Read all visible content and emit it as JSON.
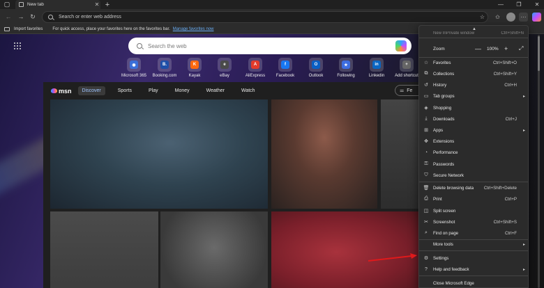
{
  "browser": {
    "tab_title": "New tab",
    "omnibox_placeholder": "Search or enter web address"
  },
  "favorites_bar": {
    "import_label": "Import favorites",
    "hint": "For quick access, place your favorites here on the favorites bar.",
    "manage_link": "Manage favorites now"
  },
  "newtab": {
    "search_placeholder": "Search the web",
    "shortcuts": [
      {
        "label": "Microsoft 365",
        "icon": "microsoft-365-icon",
        "color": "#3a6fd8",
        "glyph": "◉"
      },
      {
        "label": "Booking.com",
        "icon": "booking-icon",
        "color": "#1e4fa8",
        "glyph": "B."
      },
      {
        "label": "Kayak",
        "icon": "kayak-icon",
        "color": "#ff690f",
        "glyph": "K"
      },
      {
        "label": "eBay",
        "icon": "ebay-icon",
        "color": "#4a4a4a",
        "glyph": "e"
      },
      {
        "label": "AliExpress",
        "icon": "aliexpress-icon",
        "color": "#e23b2b",
        "glyph": "A"
      },
      {
        "label": "Facebook",
        "icon": "facebook-icon",
        "color": "#1877f2",
        "glyph": "f"
      },
      {
        "label": "Outlook",
        "icon": "outlook-icon",
        "color": "#0a5fc4",
        "glyph": "O"
      },
      {
        "label": "Following",
        "icon": "following-icon",
        "color": "#3d6de0",
        "glyph": "★"
      },
      {
        "label": "Linkedin",
        "icon": "linkedin-icon",
        "color": "#0a66c2",
        "glyph": "in"
      },
      {
        "label": "Add shortcut",
        "icon": "plus-icon",
        "color": "#666666",
        "glyph": "+"
      }
    ]
  },
  "msn": {
    "logo": "msn",
    "tabs": [
      "Discover",
      "Sports",
      "Play",
      "Money",
      "Weather",
      "Watch"
    ],
    "right_button": "Fe"
  },
  "menu": {
    "cut_off_item": "New InPrivate window",
    "cut_off_shortcut": "Ctrl+Shift+N",
    "zoom_label": "Zoom",
    "zoom_value": "100%",
    "items": [
      {
        "label": "Favorites",
        "shortcut": "Ctrl+Shift+O",
        "icon": "star-icon",
        "glyph": "☆",
        "arrow": false
      },
      {
        "label": "Collections",
        "shortcut": "Ctrl+Shift+Y",
        "icon": "collections-icon",
        "glyph": "⧉",
        "arrow": false
      },
      {
        "label": "History",
        "shortcut": "Ctrl+H",
        "icon": "history-icon",
        "glyph": "↺",
        "arrow": false
      },
      {
        "label": "Tab groups",
        "shortcut": "",
        "icon": "tab-groups-icon",
        "glyph": "▭",
        "arrow": true
      },
      {
        "label": "Shopping",
        "shortcut": "",
        "icon": "shopping-icon",
        "glyph": "◈",
        "arrow": false
      },
      {
        "label": "Downloads",
        "shortcut": "Ctrl+J",
        "icon": "download-icon",
        "glyph": "⤓",
        "arrow": false
      },
      {
        "label": "Apps",
        "shortcut": "",
        "icon": "apps-icon",
        "glyph": "⊞",
        "arrow": true
      },
      {
        "label": "Extensions",
        "shortcut": "",
        "icon": "extensions-icon",
        "glyph": "✥",
        "arrow": false
      },
      {
        "label": "Performance",
        "shortcut": "",
        "icon": "performance-icon",
        "glyph": "◔",
        "arrow": false
      },
      {
        "label": "Passwords",
        "shortcut": "",
        "icon": "key-icon",
        "glyph": "⚿",
        "arrow": false
      },
      {
        "label": "Secure Network",
        "shortcut": "",
        "icon": "shield-icon",
        "glyph": "⛉",
        "arrow": false
      },
      {
        "label": "Delete browsing data",
        "shortcut": "Ctrl+Shift+Delete",
        "icon": "trash-icon",
        "glyph": "🗑",
        "arrow": false
      },
      {
        "label": "Print",
        "shortcut": "Ctrl+P",
        "icon": "print-icon",
        "glyph": "⎙",
        "arrow": false
      },
      {
        "label": "Split screen",
        "shortcut": "",
        "icon": "split-screen-icon",
        "glyph": "◫",
        "arrow": false
      },
      {
        "label": "Screenshot",
        "shortcut": "Ctrl+Shift+S",
        "icon": "screenshot-icon",
        "glyph": "✂",
        "arrow": false
      },
      {
        "label": "Find on page",
        "shortcut": "Ctrl+F",
        "icon": "find-icon",
        "glyph": "⌕",
        "arrow": false
      },
      {
        "label": "More tools",
        "shortcut": "",
        "icon": "",
        "glyph": "",
        "arrow": true
      },
      {
        "label": "Settings",
        "shortcut": "",
        "icon": "gear-icon",
        "glyph": "⚙",
        "arrow": false
      },
      {
        "label": "Help and feedback",
        "shortcut": "",
        "icon": "help-icon",
        "glyph": "?",
        "arrow": true
      },
      {
        "label": "Close Microsoft Edge",
        "shortcut": "",
        "icon": "",
        "glyph": "",
        "arrow": false
      }
    ]
  },
  "colors": {
    "accent_link": "#6aaef5",
    "annotation_arrow": "#e0191b"
  }
}
